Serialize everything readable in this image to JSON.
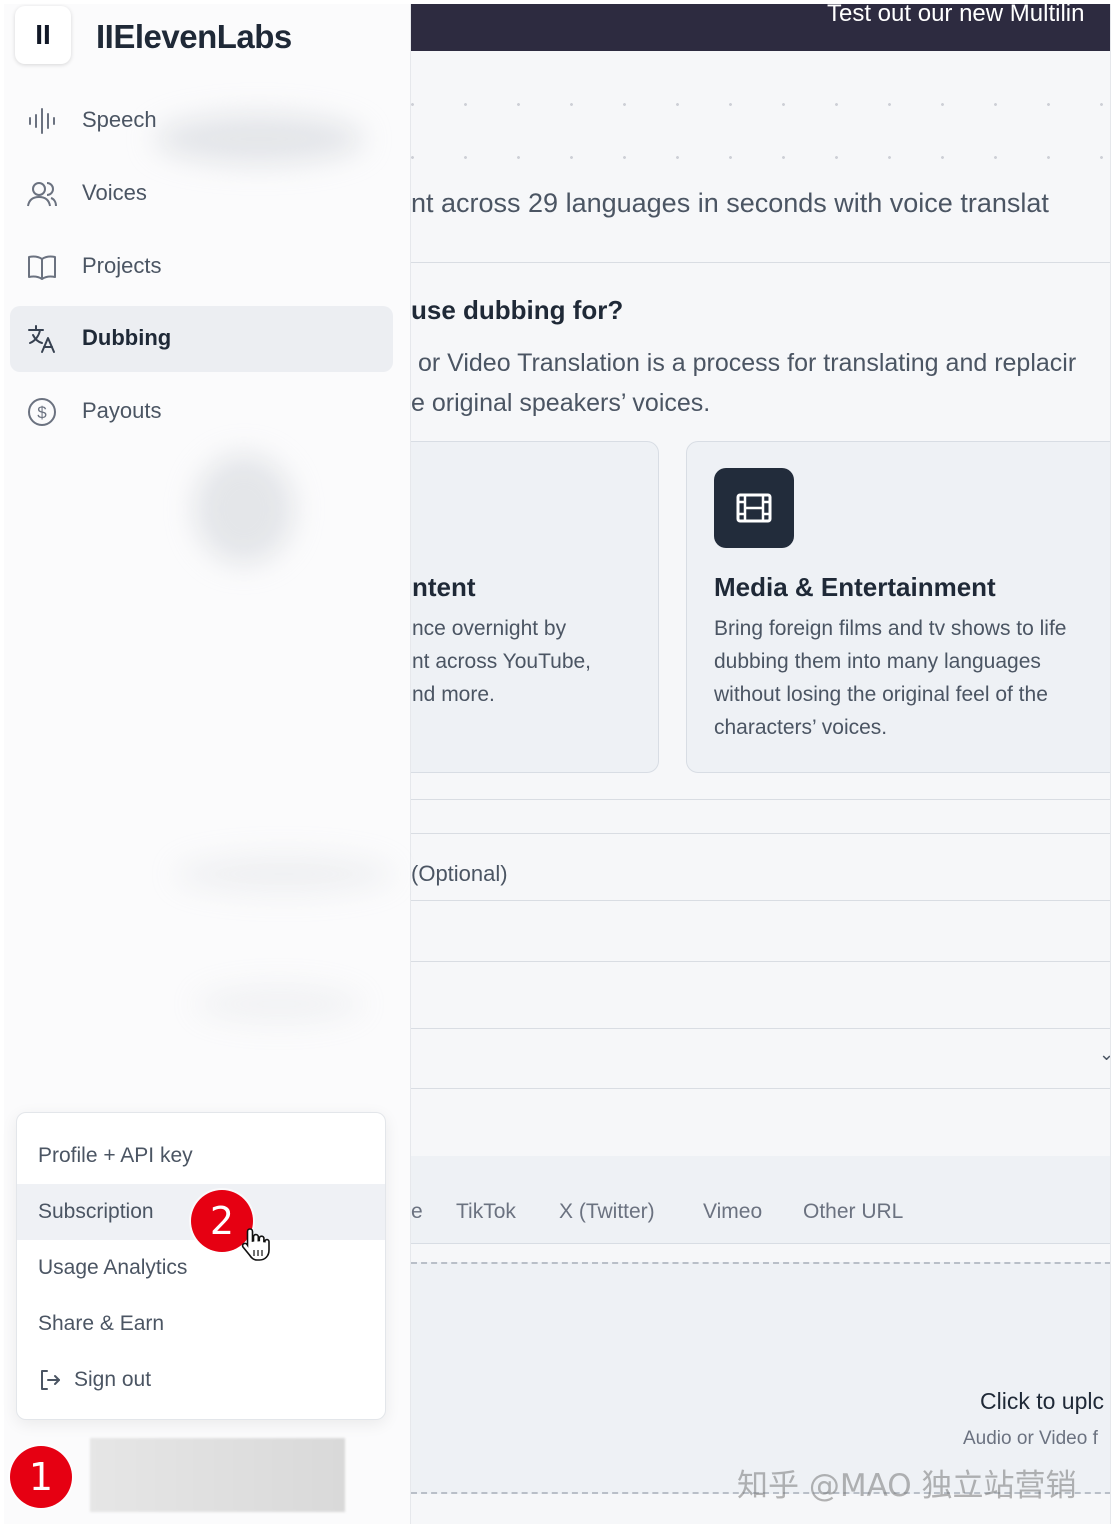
{
  "brand": {
    "button_glyph": "II",
    "name": "IIElevenLabs"
  },
  "sidebar": {
    "items": [
      {
        "label": "Speech",
        "icon": "waveform-icon",
        "active": false
      },
      {
        "label": "Voices",
        "icon": "users-icon",
        "active": false
      },
      {
        "label": "Projects",
        "icon": "book-icon",
        "active": false
      },
      {
        "label": "Dubbing",
        "icon": "translate-icon",
        "active": true
      },
      {
        "label": "Payouts",
        "icon": "dollar-circle-icon",
        "active": false
      }
    ]
  },
  "account_menu": {
    "items": [
      {
        "label": "Profile + API key"
      },
      {
        "label": "Subscription",
        "hovered": true
      },
      {
        "label": "Usage Analytics"
      },
      {
        "label": "Share & Earn"
      },
      {
        "label": "Sign out",
        "icon": "sign-out-icon"
      }
    ]
  },
  "banner": {
    "text": "Test out our new Multilin"
  },
  "main": {
    "intro": "nt across 29 languages in seconds with voice translat",
    "question_title": "use dubbing for?",
    "question_body": [
      " or Video Translation is a process for translating and replacir",
      "e original speakers’ voices."
    ],
    "cards": [
      {
        "title": "ntent",
        "body": [
          "nce overnight by",
          "nt across YouTube,",
          "nd more."
        ]
      },
      {
        "title": "Media & Entertainment",
        "icon": "film-icon",
        "body": [
          "Bring foreign films and tv shows to life",
          "dubbing them into many languages",
          "without losing the original feel of the",
          "characters’ voices."
        ]
      }
    ],
    "optional_label": "(Optional)",
    "source_tabs": [
      "e",
      "TikTok",
      "X (Twitter)",
      "Vimeo",
      "Other URL"
    ],
    "upload": {
      "title": "Click to uplc",
      "subtitle": "Audio or Video f"
    }
  },
  "annotations": {
    "marker_1": "1",
    "marker_2": "2"
  },
  "watermark": "知乎 @MAO 独立站营销",
  "colors": {
    "banner_bg": "#2d2b40",
    "marker_red": "#e60012",
    "card_icon_bg": "#222c3b"
  }
}
